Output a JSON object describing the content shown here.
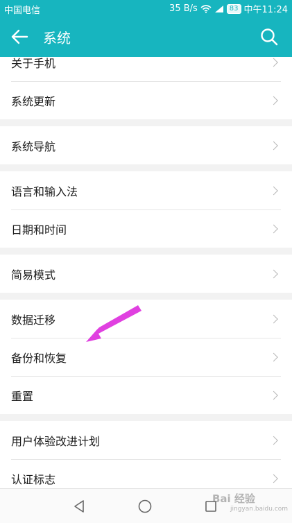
{
  "status_bar": {
    "carrier": "中国电信",
    "network_speed": "35 B/s",
    "battery": "83",
    "time": "中午11:24"
  },
  "header": {
    "title": "系统"
  },
  "groups": [
    {
      "items": [
        {
          "label": "关于手机"
        },
        {
          "label": "系统更新"
        }
      ]
    },
    {
      "items": [
        {
          "label": "系统导航"
        }
      ]
    },
    {
      "items": [
        {
          "label": "语言和输入法"
        },
        {
          "label": "日期和时间"
        }
      ]
    },
    {
      "items": [
        {
          "label": "简易模式"
        }
      ]
    },
    {
      "items": [
        {
          "label": "数据迁移"
        },
        {
          "label": "备份和恢复"
        },
        {
          "label": "重置"
        }
      ]
    },
    {
      "items": [
        {
          "label": "用户体验改进计划"
        },
        {
          "label": "认证标志"
        }
      ]
    }
  ],
  "watermark": {
    "text": "Bai 经验",
    "sub": "jingyan.baidu.com"
  },
  "colors": {
    "accent": "#17b5bf",
    "annotation": "#e040e0"
  },
  "icons": {
    "back": "arrow-left-icon",
    "search": "search-icon",
    "nav_back": "triangle-back-icon",
    "nav_home": "circle-home-icon",
    "nav_recent": "square-recent-icon"
  }
}
